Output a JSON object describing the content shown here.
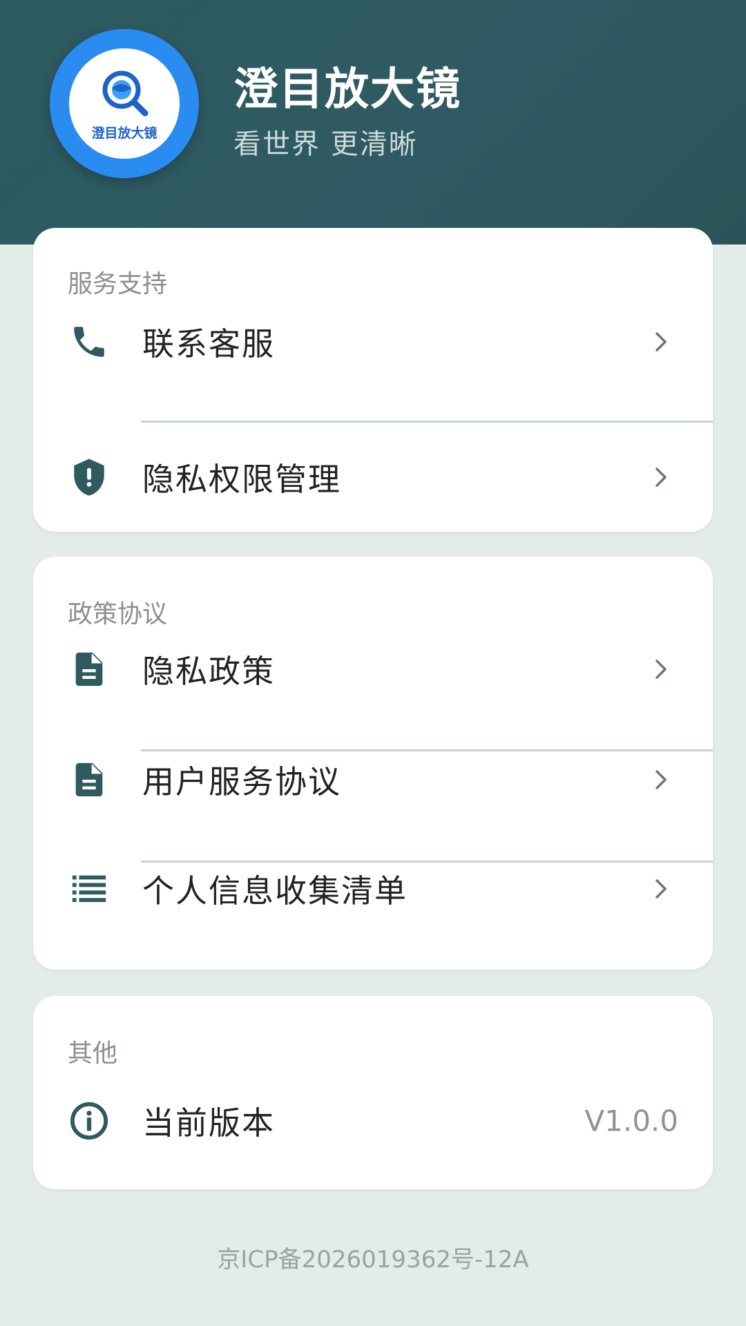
{
  "header": {
    "title": "澄目放大镜",
    "subtitle": "看世界 更清晰",
    "logo_text": "澄目放大镜"
  },
  "sections": [
    {
      "title": "服务支持",
      "items": [
        {
          "label": "联系客服",
          "icon": "phone-icon"
        },
        {
          "label": "隐私权限管理",
          "icon": "shield-icon"
        }
      ]
    },
    {
      "title": "政策协议",
      "items": [
        {
          "label": "隐私政策",
          "icon": "document-icon"
        },
        {
          "label": "用户服务协议",
          "icon": "document-icon"
        },
        {
          "label": "个人信息收集清单",
          "icon": "list-icon"
        }
      ]
    },
    {
      "title": "其他",
      "items": [
        {
          "label": "当前版本",
          "icon": "info-icon",
          "value": "V1.0.0"
        }
      ]
    }
  ],
  "footer": {
    "icp": "京ICP备2026019362号-12A"
  },
  "colors": {
    "header_bg": "#2c5b60",
    "icon": "#2f5a5e",
    "accent_blue": "#2a8cf0",
    "page_bg": "#e4ecea"
  }
}
